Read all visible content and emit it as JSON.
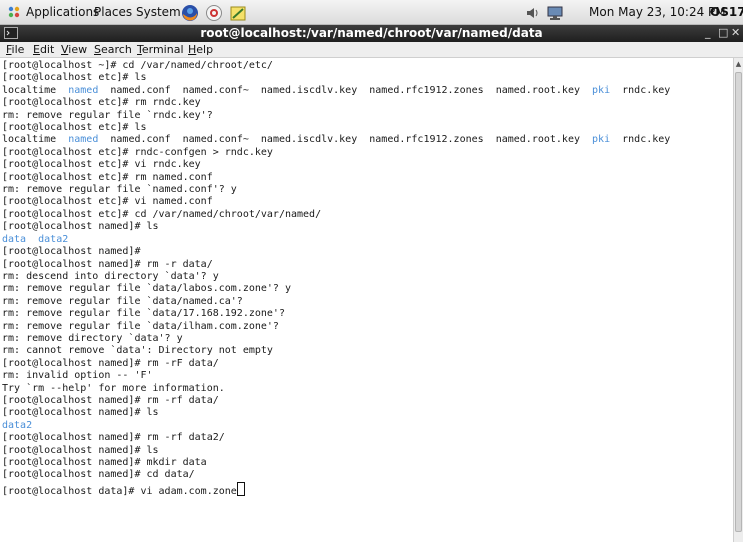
{
  "top_panel": {
    "applications": "Applications",
    "places": "Places",
    "system": "System",
    "clock": "Mon May 23, 10:24 PM",
    "os_label": "OS17"
  },
  "window": {
    "title": "root@localhost:/var/named/chroot/var/named/data",
    "minimize": "_",
    "maximize": "□",
    "close": "✕"
  },
  "menu": {
    "file": "File",
    "edit": "Edit",
    "view": "View",
    "search": "Search",
    "terminal": "Terminal",
    "help": "Help"
  },
  "terminal": {
    "lines": [
      {
        "segs": [
          {
            "t": "[root@localhost ~]# cd /var/named/chroot/etc/"
          }
        ]
      },
      {
        "segs": [
          {
            "t": "[root@localhost etc]# ls"
          }
        ]
      },
      {
        "segs": [
          {
            "t": "localtime  "
          },
          {
            "t": "named",
            "c": "dir"
          },
          {
            "t": "  named.conf  named.conf~  named.iscdlv.key  named.rfc1912.zones  named.root.key  "
          },
          {
            "t": "pki",
            "c": "dir"
          },
          {
            "t": "  rndc.key"
          }
        ]
      },
      {
        "segs": [
          {
            "t": "[root@localhost etc]# rm rndc.key"
          }
        ]
      },
      {
        "segs": [
          {
            "t": "rm: remove regular file `rndc.key'?"
          }
        ]
      },
      {
        "segs": [
          {
            "t": "[root@localhost etc]# ls"
          }
        ]
      },
      {
        "segs": [
          {
            "t": "localtime  "
          },
          {
            "t": "named",
            "c": "dir"
          },
          {
            "t": "  named.conf  named.conf~  named.iscdlv.key  named.rfc1912.zones  named.root.key  "
          },
          {
            "t": "pki",
            "c": "dir"
          },
          {
            "t": "  rndc.key"
          }
        ]
      },
      {
        "segs": [
          {
            "t": "[root@localhost etc]# rndc-confgen > rndc.key"
          }
        ]
      },
      {
        "segs": [
          {
            "t": "[root@localhost etc]# vi rndc.key"
          }
        ]
      },
      {
        "segs": [
          {
            "t": "[root@localhost etc]# rm named.conf"
          }
        ]
      },
      {
        "segs": [
          {
            "t": "rm: remove regular file `named.conf'? y"
          }
        ]
      },
      {
        "segs": [
          {
            "t": "[root@localhost etc]# vi named.conf"
          }
        ]
      },
      {
        "segs": [
          {
            "t": "[root@localhost etc]# cd /var/named/chroot/var/named/"
          }
        ]
      },
      {
        "segs": [
          {
            "t": "[root@localhost named]# ls"
          }
        ]
      },
      {
        "segs": [
          {
            "t": "data",
            "c": "dir"
          },
          {
            "t": "  "
          },
          {
            "t": "data2",
            "c": "dir"
          }
        ]
      },
      {
        "segs": [
          {
            "t": "[root@localhost named]#"
          }
        ]
      },
      {
        "segs": [
          {
            "t": "[root@localhost named]# rm -r data/"
          }
        ]
      },
      {
        "segs": [
          {
            "t": "rm: descend into directory `data'? y"
          }
        ]
      },
      {
        "segs": [
          {
            "t": "rm: remove regular file `data/labos.com.zone'? y"
          }
        ]
      },
      {
        "segs": [
          {
            "t": "rm: remove regular file `data/named.ca'?"
          }
        ]
      },
      {
        "segs": [
          {
            "t": "rm: remove regular file `data/17.168.192.zone'?"
          }
        ]
      },
      {
        "segs": [
          {
            "t": "rm: remove regular file `data/ilham.com.zone'?"
          }
        ]
      },
      {
        "segs": [
          {
            "t": "rm: remove directory `data'? y"
          }
        ]
      },
      {
        "segs": [
          {
            "t": "rm: cannot remove `data': Directory not empty"
          }
        ]
      },
      {
        "segs": [
          {
            "t": "[root@localhost named]# rm -rF data/"
          }
        ]
      },
      {
        "segs": [
          {
            "t": "rm: invalid option -- 'F'"
          }
        ]
      },
      {
        "segs": [
          {
            "t": "Try `rm --help' for more information."
          }
        ]
      },
      {
        "segs": [
          {
            "t": "[root@localhost named]# rm -rf data/"
          }
        ]
      },
      {
        "segs": [
          {
            "t": "[root@localhost named]# ls"
          }
        ]
      },
      {
        "segs": [
          {
            "t": "data2",
            "c": "dir"
          }
        ]
      },
      {
        "segs": [
          {
            "t": "[root@localhost named]# rm -rf data2/"
          }
        ]
      },
      {
        "segs": [
          {
            "t": "[root@localhost named]# ls"
          }
        ]
      },
      {
        "segs": [
          {
            "t": "[root@localhost named]# mkdir data"
          }
        ]
      },
      {
        "segs": [
          {
            "t": "[root@localhost named]# cd data/"
          }
        ]
      },
      {
        "segs": [
          {
            "t": "[root@localhost data]# vi adam.com.zone"
          }
        ],
        "cursor": true
      }
    ]
  },
  "colors": {
    "directory": "#4a8fd8",
    "titlebar": "#2b2b2b"
  }
}
